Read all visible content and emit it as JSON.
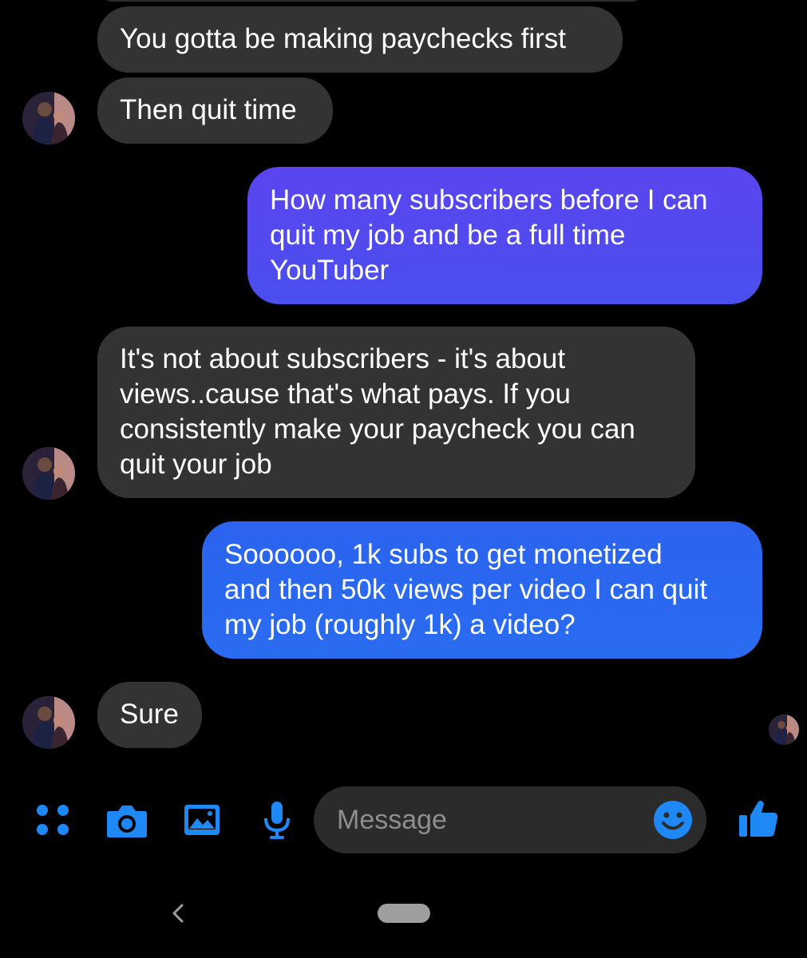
{
  "conversation": {
    "messages": [
      {
        "sender": "contact",
        "lines": [
          "You gotta be making paychecks first"
        ]
      },
      {
        "sender": "contact",
        "lines": [
          "Then quit time"
        ]
      },
      {
        "sender": "me",
        "lines": [
          "How many subscribers before I can",
          "quit my job and be a full time",
          "YouTuber"
        ]
      },
      {
        "sender": "contact",
        "lines": [
          "It's not about subscribers - it's about",
          "views..cause that's what pays. If you",
          "consistently make your paycheck you can",
          "quit your job"
        ]
      },
      {
        "sender": "me",
        "lines": [
          "Soooooo, 1k subs to get monetized",
          "and then 50k views per video I can quit",
          "my job (roughly 1k) a video?"
        ]
      },
      {
        "sender": "contact",
        "lines": [
          "Sure"
        ]
      }
    ]
  },
  "composer": {
    "placeholder": "Message",
    "icons": {
      "menu": "four-dots-icon",
      "camera": "camera-icon",
      "gallery": "image-icon",
      "voice": "microphone-icon",
      "emoji": "smiley-icon",
      "send": "thumbs-up-icon"
    }
  },
  "navigation": {
    "back_glyph": "‹"
  },
  "colors": {
    "background": "#000000",
    "incoming_bubble": "#333333",
    "outgoing_bubble_purple": "#5046ee",
    "outgoing_bubble_blue": "#2a68ef",
    "accent": "#1e88f5",
    "placeholder": "#8e8e8e"
  }
}
